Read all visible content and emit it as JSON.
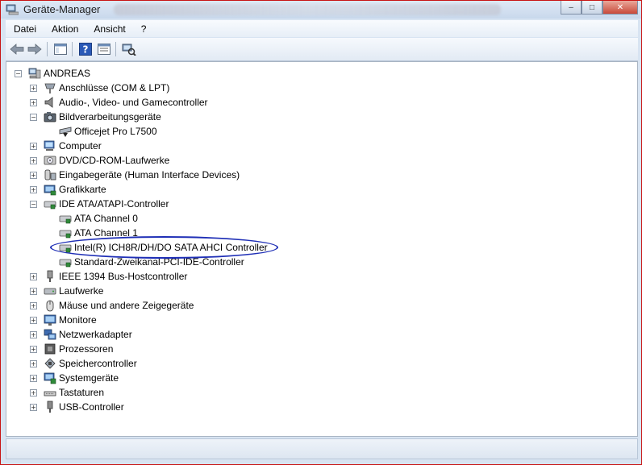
{
  "window": {
    "title": "Geräte-Manager",
    "minimize_glyph": "–",
    "maximize_glyph": "□",
    "close_glyph": "✕"
  },
  "menu": {
    "items": [
      "Datei",
      "Aktion",
      "Ansicht",
      "?"
    ]
  },
  "toolbar": {
    "buttons": [
      "back-icon",
      "forward-icon",
      "console-tree-icon",
      "help-icon",
      "properties-icon",
      "scan-hardware-icon"
    ]
  },
  "tree": {
    "root": "ANDREAS",
    "items": [
      {
        "label": "Anschlüsse (COM & LPT)",
        "icon": "port-icon",
        "expanded": false
      },
      {
        "label": "Audio-, Video- und Gamecontroller",
        "icon": "speaker-icon",
        "expanded": false
      },
      {
        "label": "Bildverarbeitungsgeräte",
        "icon": "camera-icon",
        "expanded": true
      },
      {
        "label": "Officejet Pro L7500",
        "icon": "scanner-icon",
        "child": true
      },
      {
        "label": "Computer",
        "icon": "computer-icon",
        "expanded": false
      },
      {
        "label": "DVD/CD-ROM-Laufwerke",
        "icon": "cd-drive-icon",
        "expanded": false
      },
      {
        "label": "Eingabegeräte (Human Interface Devices)",
        "icon": "hid-icon",
        "expanded": false
      },
      {
        "label": "Grafikkarte",
        "icon": "display-adapter-icon",
        "expanded": false
      },
      {
        "label": "IDE ATA/ATAPI-Controller",
        "icon": "ide-controller-icon",
        "expanded": true
      },
      {
        "label": "ATA Channel 0",
        "icon": "ide-channel-icon",
        "child": true
      },
      {
        "label": "ATA Channel 1",
        "icon": "ide-channel-icon",
        "child": true
      },
      {
        "label": "Intel(R) ICH8R/DH/DO SATA AHCI Controller",
        "icon": "ide-channel-icon",
        "child": true,
        "circled": true
      },
      {
        "label": "Standard-Zweikanal-PCI-IDE-Controller",
        "icon": "ide-channel-icon",
        "child": true
      },
      {
        "label": "IEEE 1394 Bus-Hostcontroller",
        "icon": "firewire-icon",
        "expanded": false
      },
      {
        "label": "Laufwerke",
        "icon": "disk-drive-icon",
        "expanded": false
      },
      {
        "label": "Mäuse und andere Zeigegeräte",
        "icon": "mouse-icon",
        "expanded": false
      },
      {
        "label": "Monitore",
        "icon": "monitor-icon",
        "expanded": false
      },
      {
        "label": "Netzwerkadapter",
        "icon": "network-icon",
        "expanded": false
      },
      {
        "label": "Prozessoren",
        "icon": "processor-icon",
        "expanded": false
      },
      {
        "label": "Speichercontroller",
        "icon": "storage-controller-icon",
        "expanded": false
      },
      {
        "label": "Systemgeräte",
        "icon": "system-icon",
        "expanded": false
      },
      {
        "label": "Tastaturen",
        "icon": "keyboard-icon",
        "expanded": false
      },
      {
        "label": "USB-Controller",
        "icon": "usb-icon",
        "expanded": false
      }
    ]
  },
  "colors": {
    "highlight_ring": "#1f2fb6",
    "window_frame": "#c81414"
  }
}
